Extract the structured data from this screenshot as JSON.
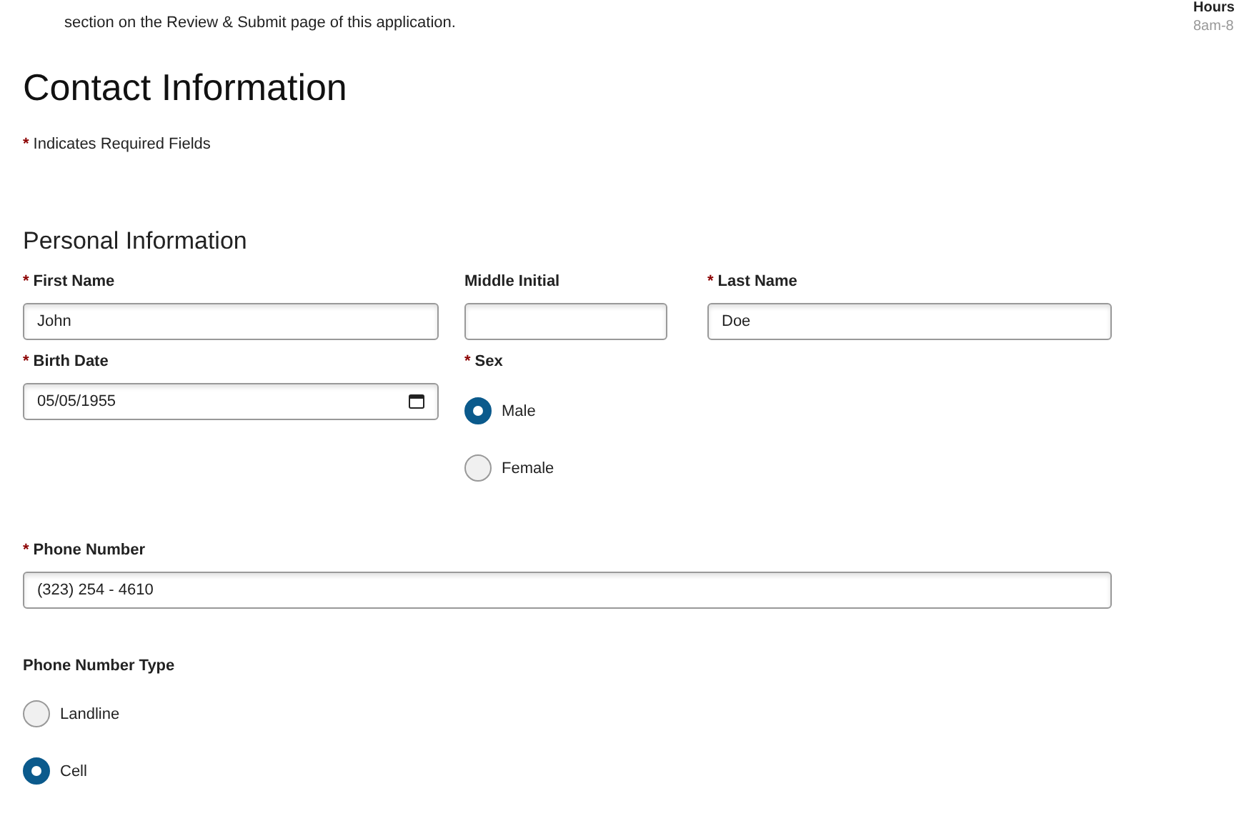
{
  "notice": {
    "text": "section on the Review & Submit page of this application."
  },
  "sidebar": {
    "heading": "Hours",
    "text": "8am-8"
  },
  "title": "Contact Information",
  "required_note": {
    "marker": "*",
    "text": "Indicates Required Fields"
  },
  "section_title": "Personal Information",
  "name_fields": [
    {
      "label": "First Name",
      "marker": "*",
      "value": "John"
    },
    {
      "label": "Middle Initial"
    },
    {
      "label": "Last Name",
      "marker": "*",
      "value": "Doe"
    }
  ],
  "birth_date": {
    "label": "Birth Date",
    "marker": "*",
    "value": "05/05/1955"
  },
  "sex": {
    "label": "Sex",
    "marker": "*",
    "options": [
      {
        "label": "Male",
        "selected": true
      },
      {
        "label": "Female",
        "selected": false
      }
    ]
  },
  "phone": {
    "label": "Phone Number",
    "marker": "*",
    "value": "(323) 254 - 4610"
  },
  "phone_type": {
    "label": "Phone Number Type",
    "options": [
      {
        "label": "Landline",
        "selected": false
      },
      {
        "label": "Cell",
        "selected": true
      }
    ]
  }
}
